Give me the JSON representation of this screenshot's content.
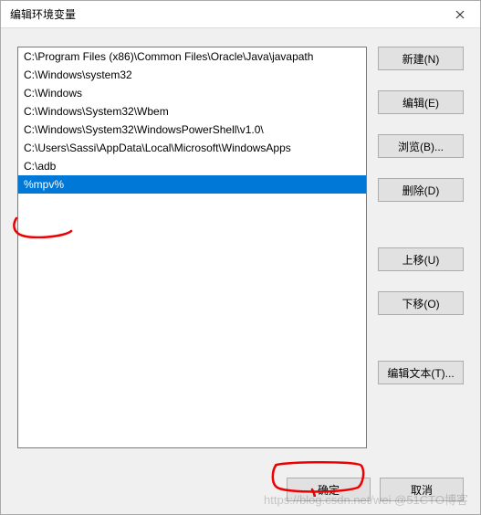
{
  "title": "编辑环境变量",
  "list": {
    "items": [
      {
        "text": "C:\\Program Files (x86)\\Common Files\\Oracle\\Java\\javapath",
        "selected": false
      },
      {
        "text": "C:\\Windows\\system32",
        "selected": false
      },
      {
        "text": "C:\\Windows",
        "selected": false
      },
      {
        "text": "C:\\Windows\\System32\\Wbem",
        "selected": false
      },
      {
        "text": "C:\\Windows\\System32\\WindowsPowerShell\\v1.0\\",
        "selected": false
      },
      {
        "text": "C:\\Users\\Sassi\\AppData\\Local\\Microsoft\\WindowsApps",
        "selected": false
      },
      {
        "text": "C:\\adb",
        "selected": false
      },
      {
        "text": "%mpv%",
        "selected": true
      }
    ]
  },
  "buttons": {
    "new": "新建(N)",
    "edit": "编辑(E)",
    "browse": "浏览(B)...",
    "delete": "删除(D)",
    "moveUp": "上移(U)",
    "moveDown": "下移(O)",
    "editText": "编辑文本(T)...",
    "ok": "确定",
    "cancel": "取消"
  },
  "watermark": "https://blog.csdn.net/wei @51CTO博客"
}
